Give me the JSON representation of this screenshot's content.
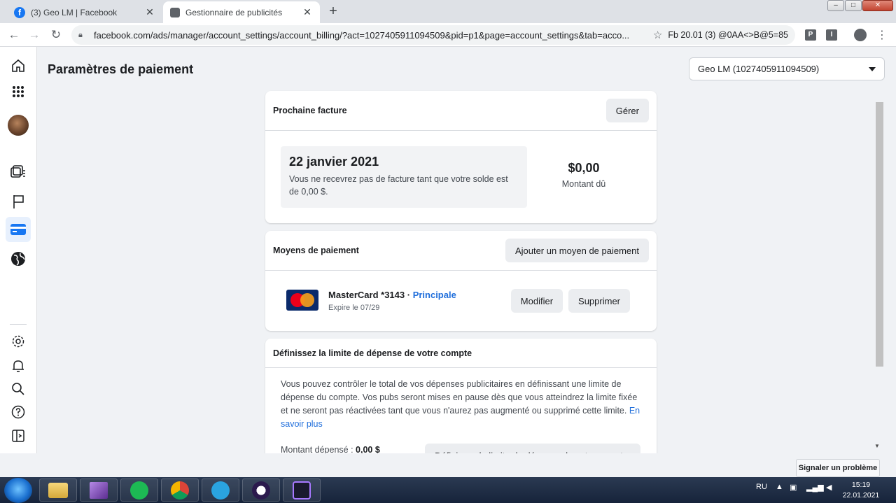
{
  "browser": {
    "tabs": [
      {
        "title": "(3) Geo LM | Facebook",
        "favicon": "f"
      },
      {
        "title": "Gestionnaire de publicités",
        "favicon": ""
      }
    ],
    "url": "facebook.com/ads/manager/account_settings/account_billing/?act=1027405911094509&pid=p1&page=account_settings&tab=acco...",
    "bookmark": "Fb 20.01 (3) @0AA<>B@5=85",
    "extensions": [
      "P",
      "I"
    ],
    "close_glyph": "✕",
    "new_tab_glyph": "+",
    "window_controls": {
      "minimize": "–",
      "maximize": "□",
      "close": "✕"
    }
  },
  "rail": {
    "icons": [
      "home-icon",
      "grid-icon",
      "avatar",
      "pages-icon",
      "flag-icon",
      "billing-card-icon",
      "globe-icon",
      "gear-icon",
      "bell-icon",
      "search-icon",
      "help-icon",
      "sidebar-toggle-icon"
    ]
  },
  "page": {
    "title": "Paramètres de paiement",
    "account_selector": "Geo LM (1027405911094509)"
  },
  "next_invoice": {
    "header": "Prochaine facture",
    "manage_button": "Gérer",
    "date": "22 janvier 2021",
    "description": "Vous ne recevrez pas de facture tant que votre solde est de 0,00 $.",
    "amount": "$0,00",
    "amount_label": "Montant dû"
  },
  "payment_methods": {
    "header": "Moyens de paiement",
    "add_button": "Ajouter un moyen de paiement",
    "card_name": "MasterCard *3143",
    "separator": " · ",
    "primary_label": "Principale",
    "logo_text": "MasterCard",
    "expiry": "Expire le 07/29",
    "edit_button": "Modifier",
    "delete_button": "Supprimer"
  },
  "spending_limit": {
    "header": "Définissez la limite de dépense de votre compte",
    "text": "Vous pouvez contrôler le total de vos dépenses publicitaires en définissant une limite de dépense du compte. Vos pubs seront mises en pause dès que vous atteindrez la limite fixée et ne seront pas réactivées tant que vous n'aurez pas augmenté ou supprimé cette limite.",
    "learn_more": "En savoir plus",
    "spent_label": "Montant dépensé : ",
    "spent_value": "0,00 $",
    "set_limit_button": "Définissez la limite de dépense de votre compte"
  },
  "report_problem": "Signaler un problème",
  "taskbar": {
    "apps": [
      "file-explorer-icon",
      "visual-studio-icon",
      "spotify-icon",
      "chrome-icon",
      "telegram-icon",
      "app-icon",
      "app2-icon"
    ],
    "language": "RU",
    "time": "15:19",
    "date": "22.01.2021"
  },
  "colors": {
    "facebook_blue": "#1877f2",
    "link_blue": "#216fdb",
    "background": "#f0f2f5",
    "button_gray": "#ebedf0"
  }
}
